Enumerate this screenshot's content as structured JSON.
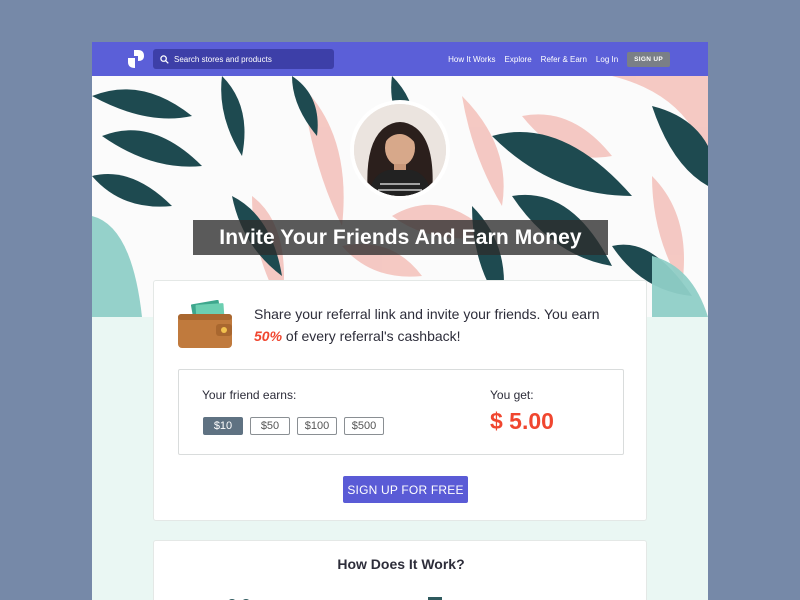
{
  "nav": {
    "search_placeholder": "Search stores and products",
    "links": [
      "How It Works",
      "Explore",
      "Refer & Earn",
      "Log In"
    ],
    "signup_label": "SIGN UP"
  },
  "hero": {
    "title": "Invite Your Friends And Earn Money"
  },
  "referral": {
    "text_before": "Share your referral link and invite your friends. You earn ",
    "percent": "50%",
    "text_after": " of every referral's cashback!",
    "friend_label": "Your friend earns:",
    "amounts": [
      "$10",
      "$50",
      "$100",
      "$500"
    ],
    "selected_amount": "$10",
    "you_label": "You get:",
    "you_value": "$ 5.00",
    "cta": "SIGN UP FOR FREE"
  },
  "how": {
    "title": "How Does It Work?"
  },
  "colors": {
    "nav": "#5b5fd8",
    "accent_red": "#f0462f",
    "button": "#5a5bd6"
  },
  "icons": [
    "logo-icon",
    "search-icon",
    "wallet-icon"
  ]
}
